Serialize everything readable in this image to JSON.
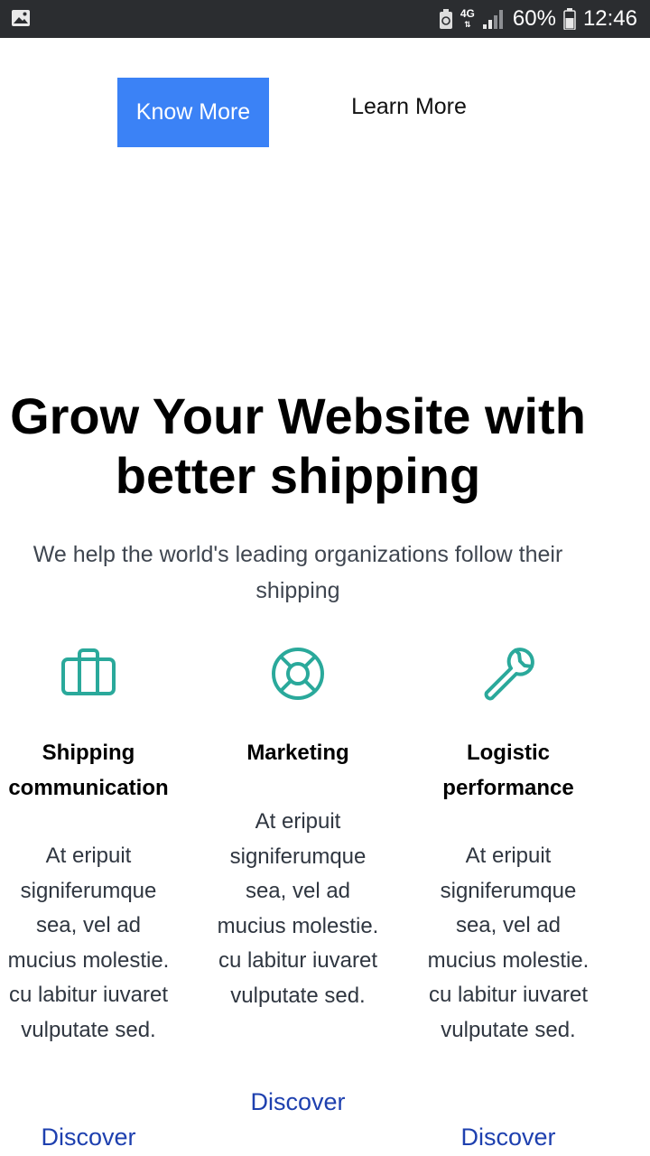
{
  "status_bar": {
    "network": "4G",
    "battery": "60%",
    "time": "12:46"
  },
  "hero": {
    "know_more_label": "Know More",
    "learn_more_label": "Learn More",
    "headline": "Grow Your Website with better shipping",
    "subtitle": "We help the world's leading organizations follow their shipping"
  },
  "colors": {
    "primary_button": "#3b82f6",
    "icon_teal": "#2aa99b",
    "link_blue": "#1e40af"
  },
  "features": [
    {
      "icon": "briefcase-icon",
      "title": "Shipping communication",
      "description": "At eripuit signiferumque sea, vel ad mucius molestie. cu labitur iuvaret vulputate sed.",
      "link": "Discover"
    },
    {
      "icon": "lifebuoy-icon",
      "title": "Marketing",
      "description": "At eripuit signiferumque sea, vel ad mucius molestie. cu labitur iuvaret vulputate sed.",
      "link": "Discover"
    },
    {
      "icon": "wrench-icon",
      "title": "Logistic performance",
      "description": "At eripuit signiferumque sea, vel ad mucius molestie. cu labitur iuvaret vulputate sed.",
      "link": "Discover"
    }
  ]
}
